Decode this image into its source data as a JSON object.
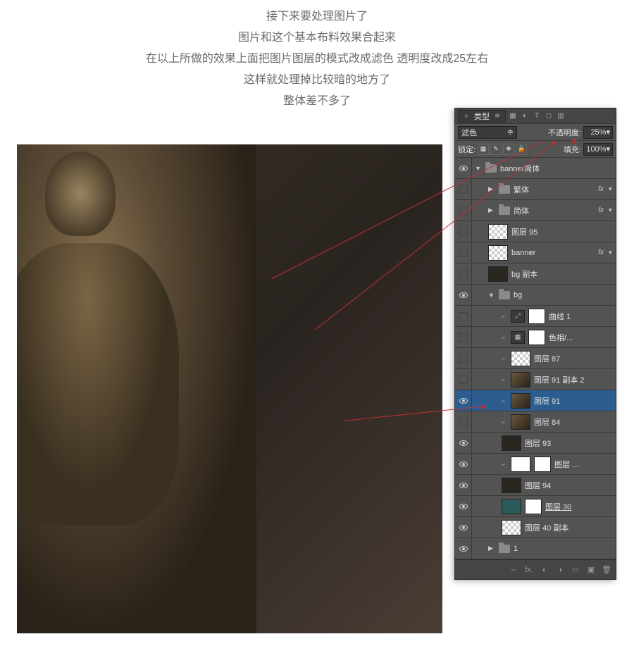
{
  "instructions": {
    "line1": "接下来要处理图片了",
    "line2": "图片和这个基本布料效果合起来",
    "line3": "在以上所做的效果上面把图片图层的模式改成滤色 透明度改成25左右",
    "line4": "这样就处理掉比较暗的地方了",
    "line5": "整体差不多了"
  },
  "panel": {
    "kind_filter": "类型",
    "blend_mode": "滤色",
    "opacity_label": "不透明度:",
    "opacity_value": "25%",
    "lock_label": "锁定:",
    "fill_label": "填充:",
    "fill_value": "100%",
    "fx_text": "fx"
  },
  "layers": {
    "g_banner": "banner简体",
    "g_fanti": "繁体",
    "g_jianti": "简体",
    "l_95": "图层 95",
    "l_banner": "banner",
    "l_bgcopy": "bg 副本",
    "g_bg": "bg",
    "l_curves": "曲线 1",
    "l_hue": "色相/...",
    "l_87": "图层 87",
    "l_91c2": "图层 91 副本 2",
    "l_91": "图层 91",
    "l_84": "图层 84",
    "l_93": "图层 93",
    "l_dots": "图层 ...",
    "l_94": "图层 94",
    "l_30": "图层 30",
    "l_40c": "图层 40 副本",
    "g_1": "1"
  },
  "bottom_icons": {
    "link": "⇔",
    "fx": "fx.",
    "mask": "◐",
    "adj": "◑",
    "folder": "▭",
    "new": "▣",
    "trash": "🗑"
  }
}
